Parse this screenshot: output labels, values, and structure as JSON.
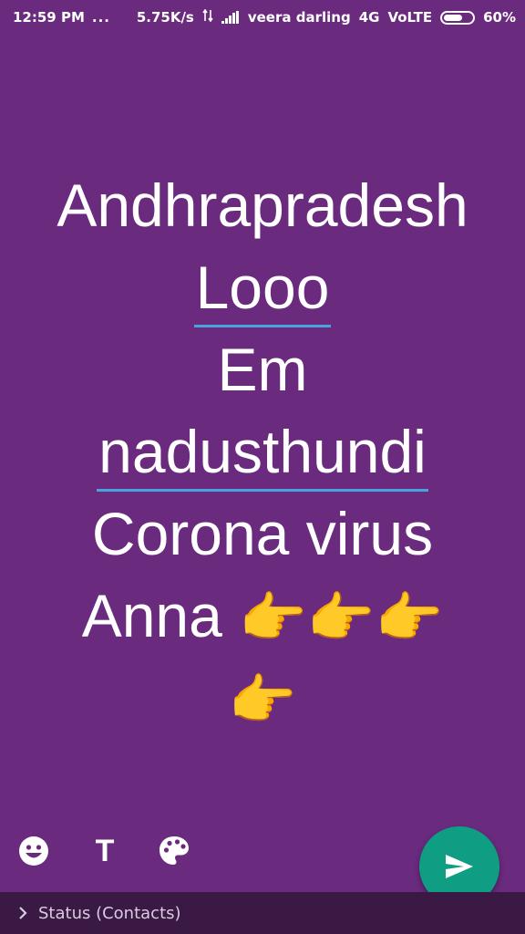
{
  "status_bar": {
    "time": "12:59 PM",
    "dots": "...",
    "speed": "5.75K/s",
    "carrier": "veera darling",
    "network": "4G",
    "volte": "VoLTE",
    "battery": "60%"
  },
  "status_text": {
    "lines": [
      "Andhrapradesh",
      "Looo",
      "Em",
      "nadusthundi",
      "Corona virus",
      "Anna"
    ],
    "emoji_inline": "👉👉👉",
    "emoji_last": "👉"
  },
  "tools": {
    "emoji_icon": "smiley-icon",
    "text_label": "T",
    "paint_icon": "palette-icon"
  },
  "send": {
    "icon": "send-icon",
    "color": "#0f9d83"
  },
  "footer": {
    "audience": "Status (Contacts)"
  },
  "colors": {
    "background": "#6a2a7e",
    "underline": "#4aa3df",
    "footer_bg": "#3a1a45"
  }
}
